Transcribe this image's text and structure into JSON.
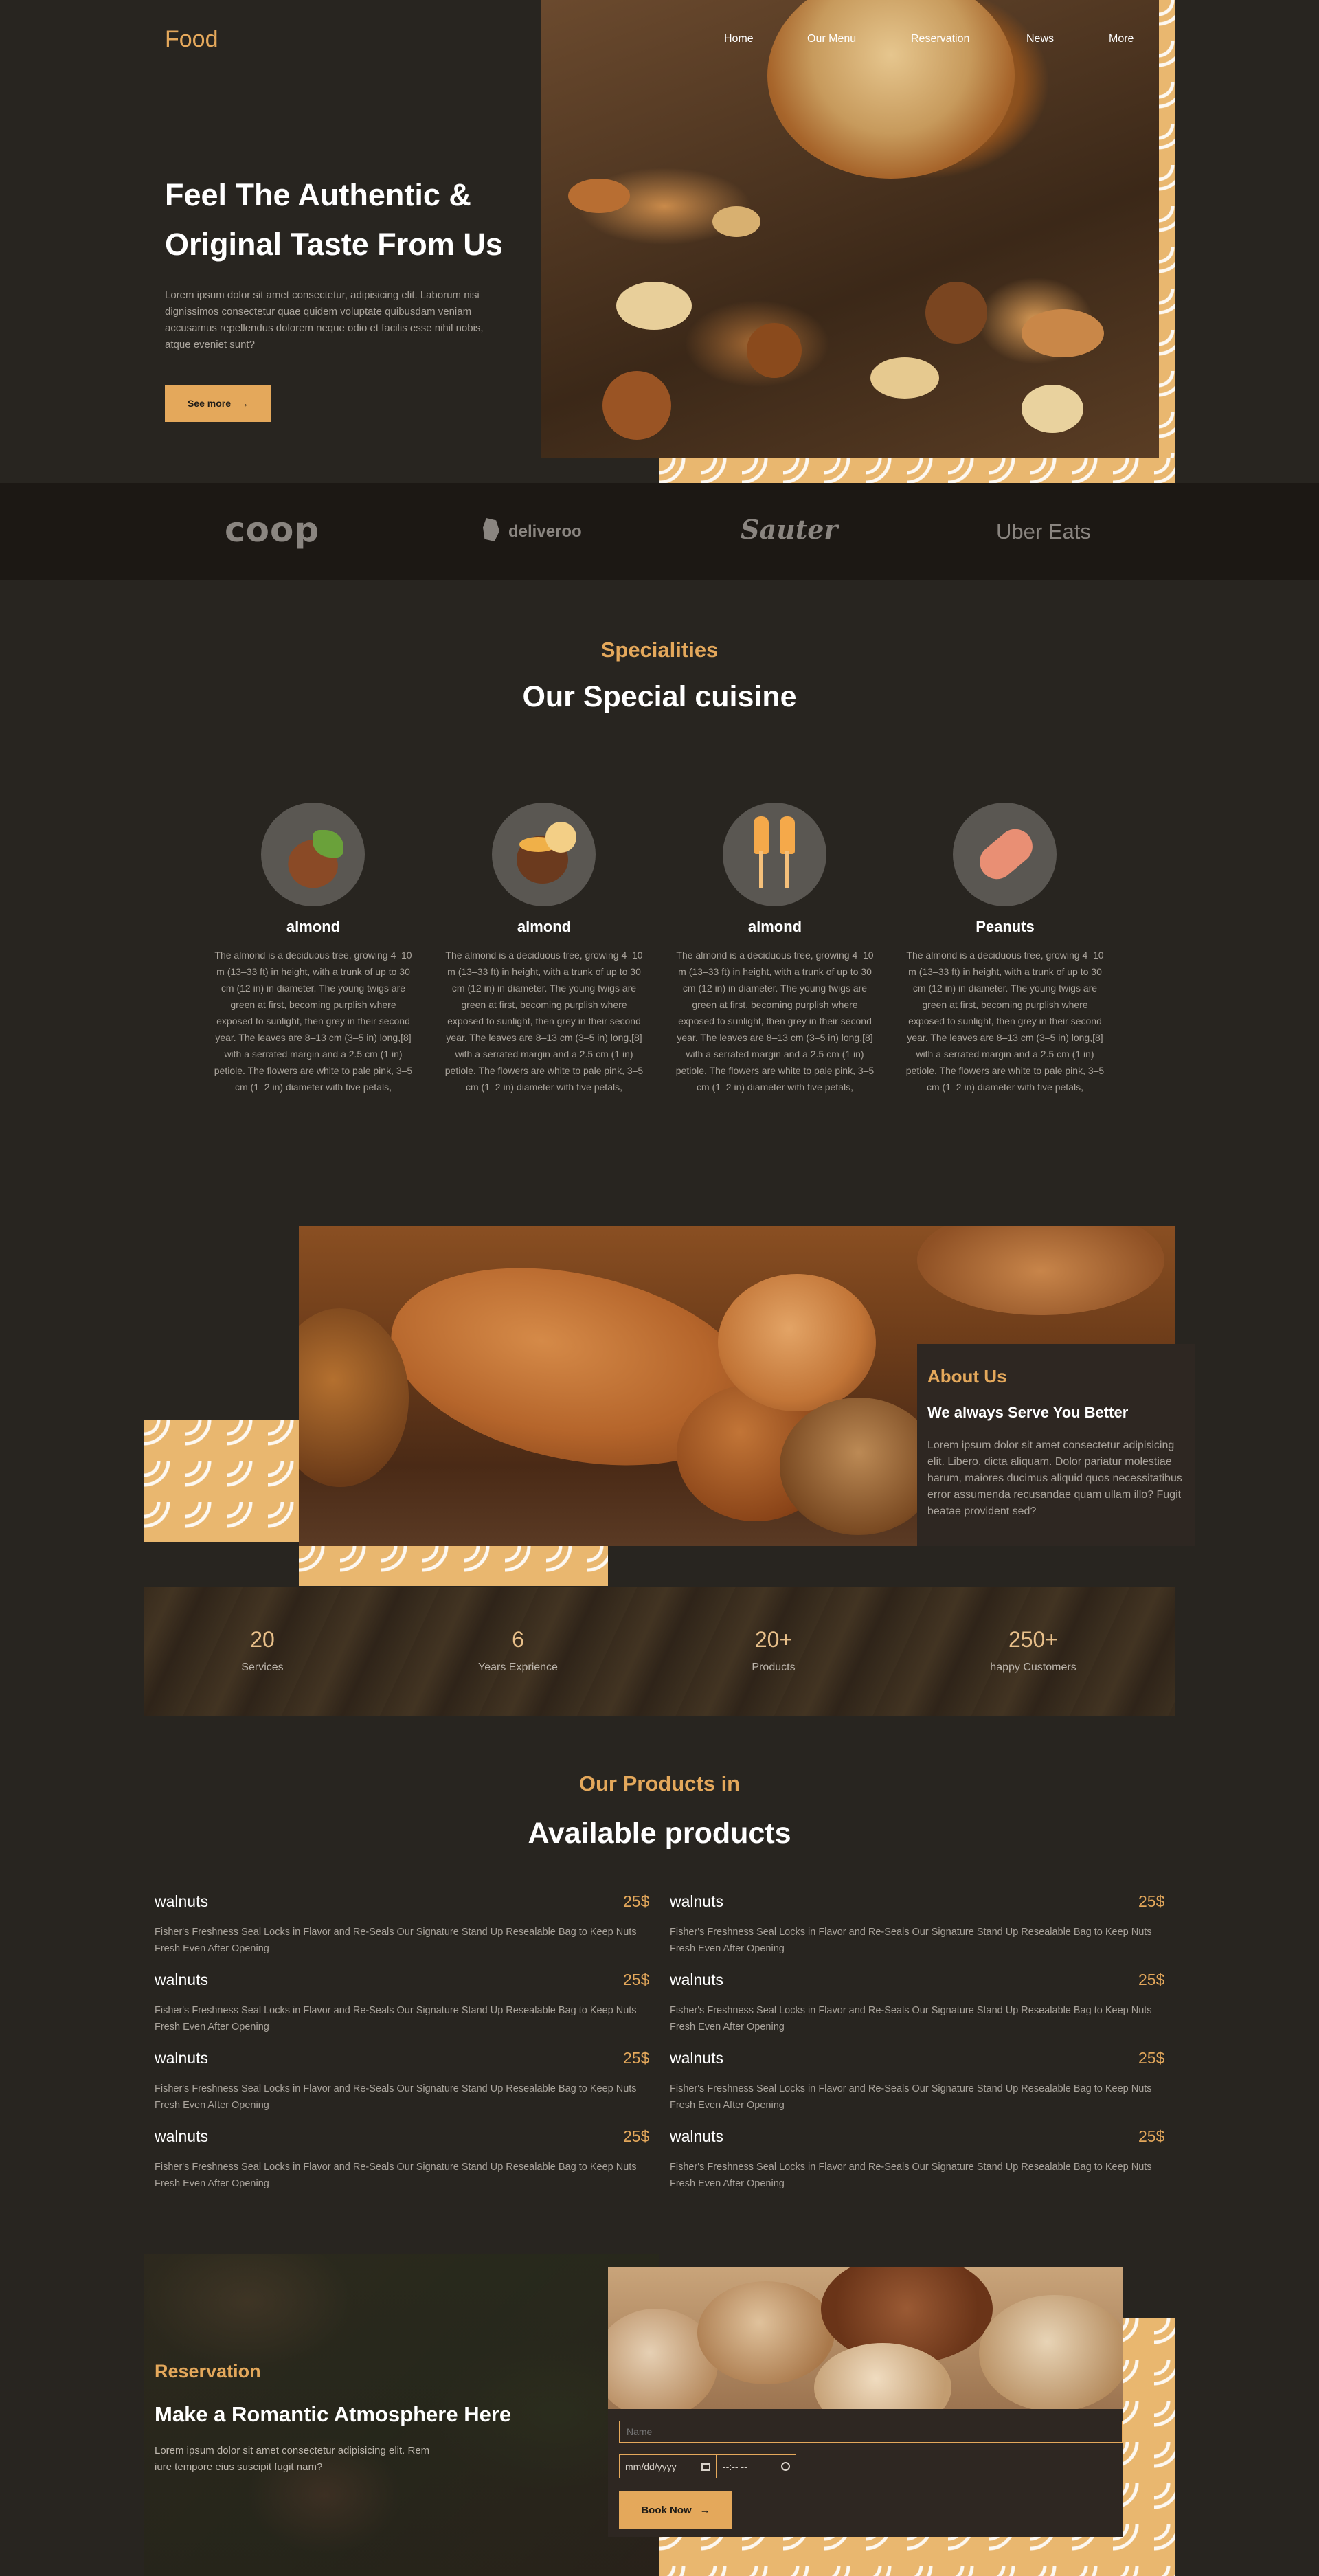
{
  "header": {
    "logo": "Food",
    "nav": [
      "Home",
      "Our Menu",
      "Reservation",
      "News",
      "More"
    ]
  },
  "hero": {
    "title_line1": "Feel The Authentic &",
    "title_line2": "Original Taste From Us",
    "text": "Lorem ipsum dolor sit amet consectetur, adipisicing elit. Laborum nisi dignissimos consectetur quae quidem voluptate quibusdam veniam accusamus repellendus dolorem neque odio et facilis esse nihil nobis, atque eveniet sunt?",
    "button": "See more",
    "button_icon": "arrow-right-icon"
  },
  "partners": [
    "coop",
    "deliveroo",
    "Sauter",
    "Uber Eats"
  ],
  "specialities": {
    "kicker": "Specialities",
    "title": "Our Special cuisine",
    "items": [
      {
        "name": "almond",
        "icon": "hazelnut-icon",
        "text": "The almond is a deciduous tree, growing 4–10 m (13–33 ft) in height, with a trunk of up to 30 cm (12 in) in diameter. The young twigs are green at first, becoming purplish where exposed to sunlight, then grey in their second year. The leaves are 8–13 cm (3–5 in) long,[8] with a serrated margin and a 2.5 cm (1 in) petiole. The flowers are white to pale pink, 3–5 cm (1–2 in) diameter with five petals,"
      },
      {
        "name": "almond",
        "icon": "chestnut-icon",
        "text": "The almond is a deciduous tree, growing 4–10 m (13–33 ft) in height, with a trunk of up to 30 cm (12 in) in diameter. The young twigs are green at first, becoming purplish where exposed to sunlight, then grey in their second year. The leaves are 8–13 cm (3–5 in) long,[8] with a serrated margin and a 2.5 cm (1 in) petiole. The flowers are white to pale pink, 3–5 cm (1–2 in) diameter with five petals,"
      },
      {
        "name": "almond",
        "icon": "wheat-icon",
        "text": "The almond is a deciduous tree, growing 4–10 m (13–33 ft) in height, with a trunk of up to 30 cm (12 in) in diameter. The young twigs are green at first, becoming purplish where exposed to sunlight, then grey in their second year. The leaves are 8–13 cm (3–5 in) long,[8] with a serrated margin and a 2.5 cm (1 in) petiole. The flowers are white to pale pink, 3–5 cm (1–2 in) diameter with five petals,"
      },
      {
        "name": "Peanuts",
        "icon": "peanut-icon",
        "text": "The almond is a deciduous tree, growing 4–10 m (13–33 ft) in height, with a trunk of up to 30 cm (12 in) in diameter. The young twigs are green at first, becoming purplish where exposed to sunlight, then grey in their second year. The leaves are 8–13 cm (3–5 in) long,[8] with a serrated margin and a 2.5 cm (1 in) petiole. The flowers are white to pale pink, 3–5 cm (1–2 in) diameter with five petals,"
      }
    ]
  },
  "about": {
    "kicker": "About Us",
    "title": "We always Serve You Better",
    "text": "Lorem ipsum dolor sit amet consectetur adipisicing elit. Libero, dicta aliquam. Dolor pariatur molestiae harum, maiores ducimus aliquid quos necessitatibus error assumenda recusandae quam ullam illo? Fugit beatae provident sed?"
  },
  "stats": [
    {
      "value": "20",
      "label": "Services"
    },
    {
      "value": "6",
      "label": "Years Exprience"
    },
    {
      "value": "20+",
      "label": "Products"
    },
    {
      "value": "250+",
      "label": "happy Customers"
    }
  ],
  "products": {
    "kicker": "Our Products in",
    "title": "Available products",
    "items": [
      {
        "name": "walnuts",
        "price": "25$",
        "desc": "Fisher's Freshness Seal Locks in Flavor and Re-Seals Our Signature Stand Up Resealable Bag to Keep Nuts Fresh Even After Opening"
      },
      {
        "name": "walnuts",
        "price": "25$",
        "desc": "Fisher's Freshness Seal Locks in Flavor and Re-Seals Our Signature Stand Up Resealable Bag to Keep Nuts Fresh Even After Opening"
      },
      {
        "name": "walnuts",
        "price": "25$",
        "desc": "Fisher's Freshness Seal Locks in Flavor and Re-Seals Our Signature Stand Up Resealable Bag to Keep Nuts Fresh Even After Opening"
      },
      {
        "name": "walnuts",
        "price": "25$",
        "desc": "Fisher's Freshness Seal Locks in Flavor and Re-Seals Our Signature Stand Up Resealable Bag to Keep Nuts Fresh Even After Opening"
      },
      {
        "name": "walnuts",
        "price": "25$",
        "desc": "Fisher's Freshness Seal Locks in Flavor and Re-Seals Our Signature Stand Up Resealable Bag to Keep Nuts Fresh Even After Opening"
      },
      {
        "name": "walnuts",
        "price": "25$",
        "desc": "Fisher's Freshness Seal Locks in Flavor and Re-Seals Our Signature Stand Up Resealable Bag to Keep Nuts Fresh Even After Opening"
      },
      {
        "name": "walnuts",
        "price": "25$",
        "desc": "Fisher's Freshness Seal Locks in Flavor and Re-Seals Our Signature Stand Up Resealable Bag to Keep Nuts Fresh Even After Opening"
      },
      {
        "name": "walnuts",
        "price": "25$",
        "desc": "Fisher's Freshness Seal Locks in Flavor and Re-Seals Our Signature Stand Up Resealable Bag to Keep Nuts Fresh Even After Opening"
      }
    ]
  },
  "reservation": {
    "kicker": "Reservation",
    "title": "Make a Romantic Atmosphere Here",
    "text": "Lorem ipsum dolor sit amet consectetur adipisicing elit. Rem iure tempore eius suscipit fugit nam?",
    "name_placeholder": "Name",
    "date_placeholder": "mm/dd/yyyy",
    "time_placeholder": "--:-- --",
    "button": "Book Now",
    "button_icon": "arrow-right-icon"
  },
  "colors": {
    "accent": "#e4a85b",
    "background": "#282520",
    "band": "#1c1814",
    "panel": "#2e2722"
  }
}
